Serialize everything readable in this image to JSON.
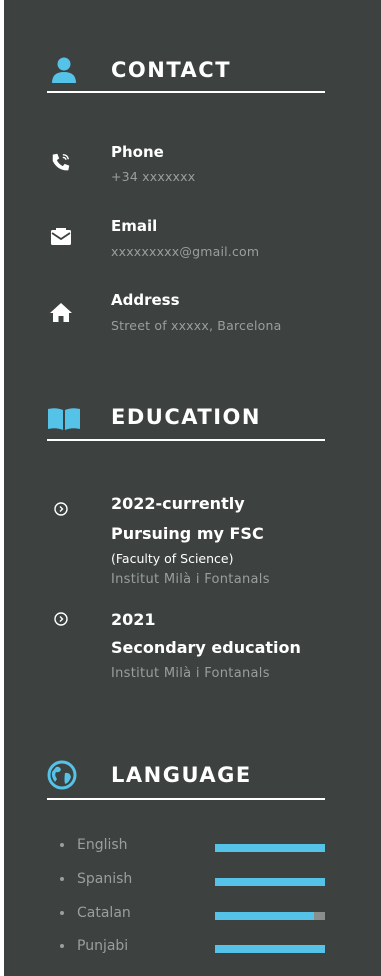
{
  "accent_color": "#55c2e8",
  "contact": {
    "title": "CONTACT",
    "icon": "person-icon",
    "items": [
      {
        "icon": "phone-icon",
        "label": "Phone",
        "value": "+34 xxxxxxx"
      },
      {
        "icon": "envelope-icon",
        "label": "Email",
        "value": "xxxxxxxxx@gmail.com"
      },
      {
        "icon": "home-icon",
        "label": "Address",
        "value": "Street of xxxxx, Barcelona"
      }
    ]
  },
  "education": {
    "title": "EDUCATION",
    "icon": "book-icon",
    "entries": [
      {
        "year": "2022-currently",
        "title": "Pursuing my FSC",
        "note": "(Faculty of Science)",
        "school": "Institut Milà i Fontanals"
      },
      {
        "year": "2021",
        "title": "Secondary education",
        "school": "Institut Milà i Fontanals"
      }
    ]
  },
  "language": {
    "title": "LANGUAGE",
    "icon": "globe-icon",
    "items": [
      {
        "name": "English",
        "level": 1.0
      },
      {
        "name": "Spanish",
        "level": 1.0
      },
      {
        "name": "Catalan",
        "level": 0.9
      },
      {
        "name": "Punjabi",
        "level": 1.0
      }
    ]
  }
}
